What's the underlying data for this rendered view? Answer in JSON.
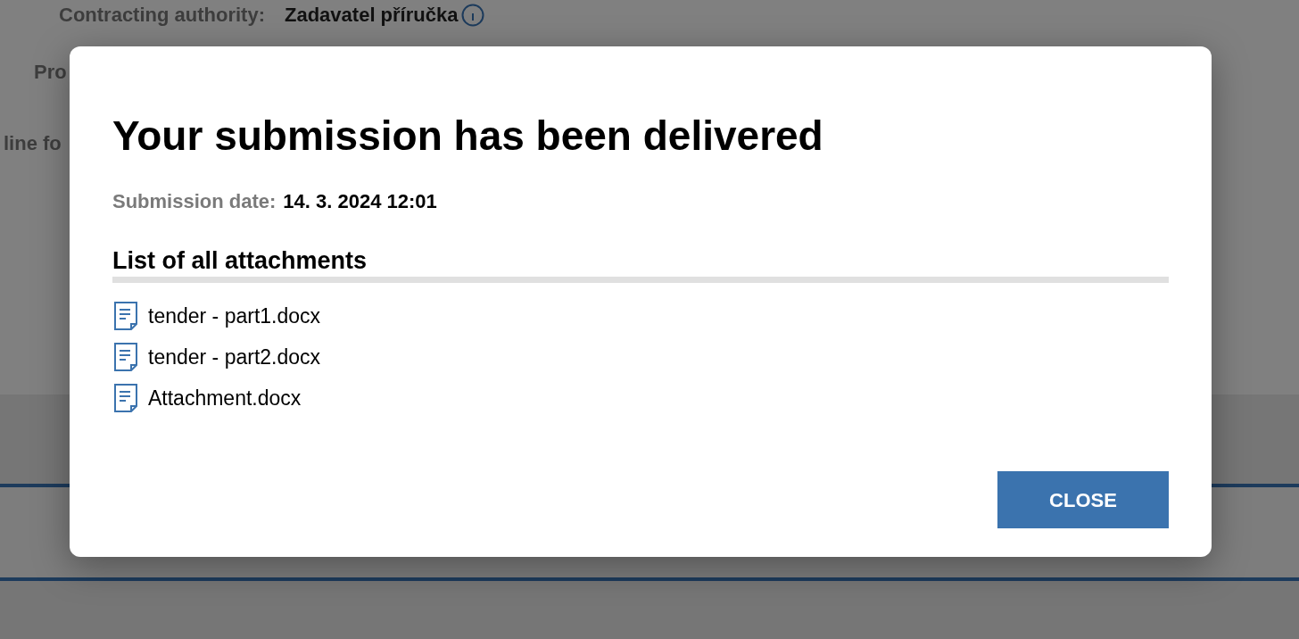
{
  "background": {
    "fields": [
      {
        "label": "Contracting authority:",
        "value": "Zadavatel příručka"
      },
      {
        "label": "Pro"
      },
      {
        "label": "line fo"
      }
    ]
  },
  "modal": {
    "title": "Your submission has been delivered",
    "date_label": "Submission date:",
    "date_value": "14. 3. 2024 12:01",
    "list_heading": "List of all attachments",
    "attachments": [
      "tender - part1.docx",
      "tender - part2.docx",
      "Attachment.docx"
    ],
    "button": "CLOSE"
  }
}
